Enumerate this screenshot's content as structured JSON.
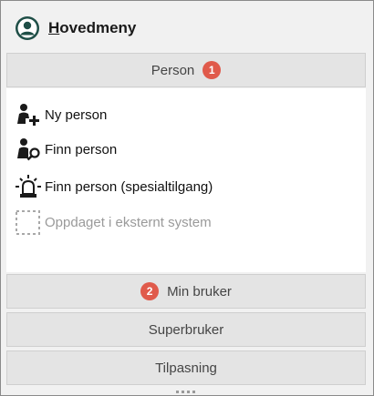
{
  "header": {
    "title_first_letter": "H",
    "title_rest": "ovedmeny",
    "icon": "user-circle-icon"
  },
  "sections": {
    "person": {
      "label": "Person",
      "badge": "1"
    },
    "min_bruker": {
      "label": "Min bruker",
      "badge": "2"
    },
    "superbruker": {
      "label": "Superbruker"
    },
    "tilpasning": {
      "label": "Tilpasning"
    }
  },
  "person_items": [
    {
      "label": "Ny person",
      "icon": "add-person-icon",
      "enabled": true
    },
    {
      "label": "Finn person",
      "icon": "find-person-icon",
      "enabled": true
    },
    {
      "label": "Finn person (spesialtilgang)",
      "icon": "alarm-beacon-icon",
      "enabled": true
    },
    {
      "label": "Oppdaget i eksternt system",
      "icon": "dashed-square-icon",
      "enabled": false
    }
  ],
  "colors": {
    "badge": "#e05a4b",
    "accent_dark": "#1f4f47"
  }
}
